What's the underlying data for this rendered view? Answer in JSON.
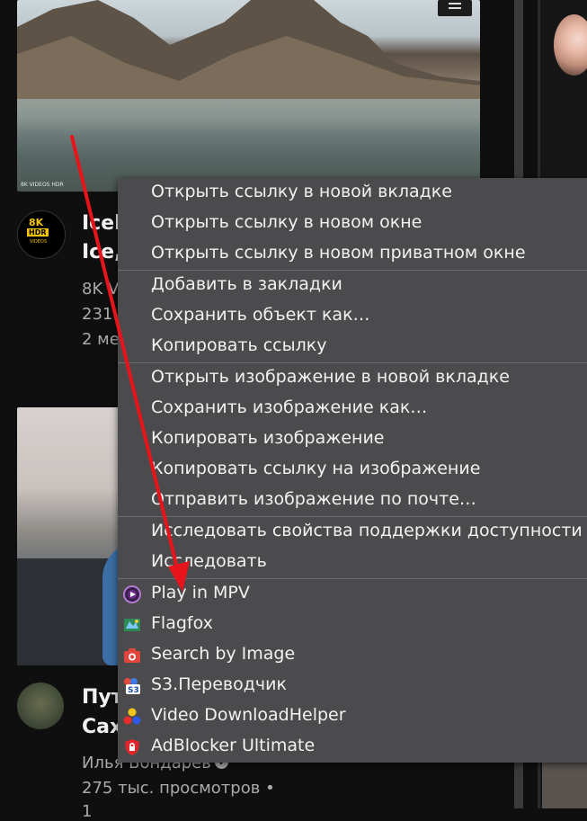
{
  "video1": {
    "thumb_tag": "8K VIDEOS HDR",
    "title_line1": "Icel",
    "title_line2": "Ice,",
    "channel": "8K V",
    "views": "231",
    "age": "2 ме",
    "logo_8k": "8K",
    "logo_hdr": "HDR",
    "logo_videos": "VIDEOS"
  },
  "video2": {
    "title_line1": "Пут",
    "title_line2": "Сах",
    "channel": "Илья Бондарев",
    "views": "275 тыс. просмотров •",
    "age": "1"
  },
  "context_menu": {
    "items": [
      {
        "label": "Открыть ссылку в новой вкладке",
        "icon": ""
      },
      {
        "label": "Открыть ссылку в новом окне",
        "icon": ""
      },
      {
        "label": "Открыть ссылку в новом приватном окне",
        "icon": ""
      },
      {
        "label": "Добавить в закладки",
        "icon": ""
      },
      {
        "label": "Сохранить объект как…",
        "icon": ""
      },
      {
        "label": "Копировать ссылку",
        "icon": ""
      },
      {
        "label": "Открыть изображение в новой вкладке",
        "icon": ""
      },
      {
        "label": "Сохранить изображение как…",
        "icon": ""
      },
      {
        "label": "Копировать изображение",
        "icon": ""
      },
      {
        "label": "Копировать ссылку на изображение",
        "icon": ""
      },
      {
        "label": "Отправить изображение по почте…",
        "icon": ""
      },
      {
        "label": "Исследовать свойства поддержки доступности",
        "icon": ""
      },
      {
        "label": "Исследовать",
        "icon": ""
      },
      {
        "label": "Play in MPV",
        "icon": "mpv-icon"
      },
      {
        "label": "Flagfox",
        "icon": "flagfox-icon"
      },
      {
        "label": "Search by Image",
        "icon": "camera-icon"
      },
      {
        "label": "S3.Переводчик",
        "icon": "s3-translator-icon"
      },
      {
        "label": "Video DownloadHelper",
        "icon": "video-downloadhelper-icon"
      },
      {
        "label": "AdBlocker Ultimate",
        "icon": "adblocker-shield-icon"
      }
    ]
  },
  "colors": {
    "background": "#0f0f0f",
    "menu_bg": "#4b4b4d",
    "annotation_arrow": "#e8141b"
  }
}
